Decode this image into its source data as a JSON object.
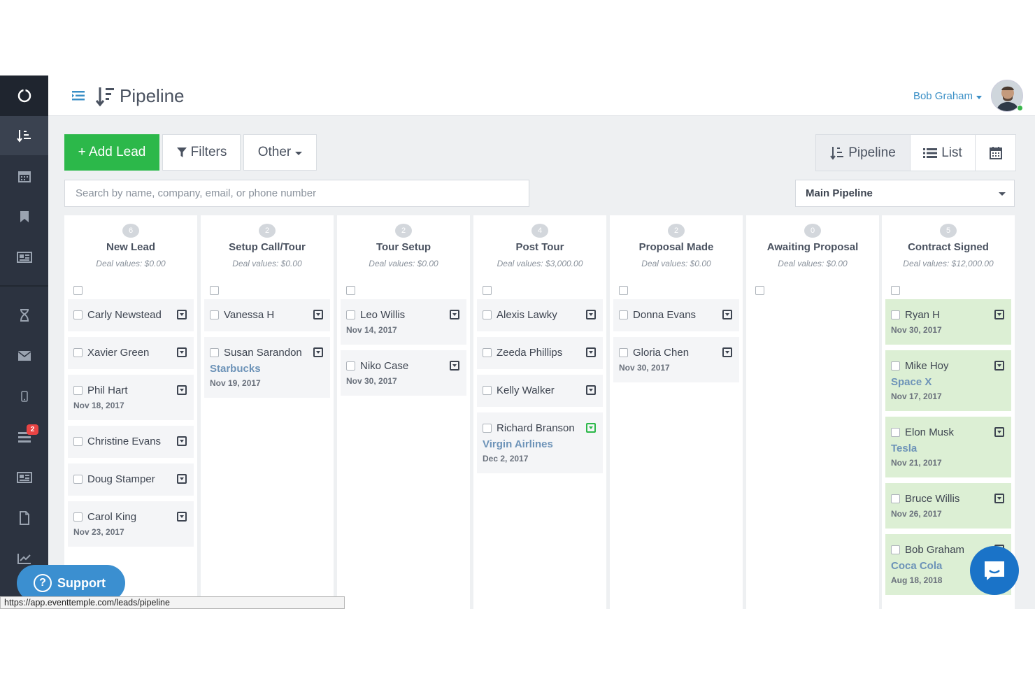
{
  "header": {
    "title": "Pipeline",
    "user_name": "Bob Graham"
  },
  "sidebar": {
    "items": [
      {
        "icon": "logo-ring-icon"
      },
      {
        "icon": "pipeline-icon",
        "active": true
      },
      {
        "icon": "calendar-icon"
      },
      {
        "icon": "bookmark-icon"
      },
      {
        "icon": "newspaper-icon"
      },
      {
        "icon": "hourglass-icon"
      },
      {
        "icon": "envelope-icon"
      },
      {
        "icon": "mobile-icon"
      },
      {
        "icon": "tasks-icon",
        "badge": "2"
      },
      {
        "icon": "newspaper-icon"
      },
      {
        "icon": "document-icon"
      },
      {
        "icon": "chart-icon"
      }
    ]
  },
  "toolbar": {
    "add_lead": "+ Add Lead",
    "filters": "Filters",
    "other": "Other",
    "view_pipeline": "Pipeline",
    "view_list": "List"
  },
  "search": {
    "placeholder": "Search by name, company, email, or phone number",
    "value": ""
  },
  "pipeline_select": {
    "value": "Main Pipeline"
  },
  "columns": [
    {
      "count": "6",
      "name": "New Lead",
      "deal_value": "Deal values: $0.00",
      "cards": [
        {
          "name": "Carly Newstead"
        },
        {
          "name": "Xavier Green"
        },
        {
          "name": "Phil Hart",
          "date": "Nov 18, 2017"
        },
        {
          "name": "Christine Evans"
        },
        {
          "name": "Doug Stamper"
        },
        {
          "name": "Carol King",
          "date": "Nov 23, 2017"
        }
      ]
    },
    {
      "count": "2",
      "name": "Setup Call/Tour",
      "deal_value": "Deal values: $0.00",
      "cards": [
        {
          "name": "Vanessa H"
        },
        {
          "name": "Susan Sarandon",
          "company": "Starbucks",
          "date": "Nov 19, 2017"
        }
      ]
    },
    {
      "count": "2",
      "name": "Tour Setup",
      "deal_value": "Deal values: $0.00",
      "cards": [
        {
          "name": "Leo Willis",
          "date": "Nov 14, 2017"
        },
        {
          "name": "Niko Case",
          "date": "Nov 30, 2017"
        }
      ]
    },
    {
      "count": "4",
      "name": "Post Tour",
      "deal_value": "Deal values: $3,000.00",
      "cards": [
        {
          "name": "Alexis Lawky"
        },
        {
          "name": "Zeeda Phillips"
        },
        {
          "name": "Kelly Walker"
        },
        {
          "name": "Richard Branson",
          "company": "Virgin Airlines",
          "date": "Dec 2, 2017",
          "menu_active": true
        }
      ]
    },
    {
      "count": "2",
      "name": "Proposal Made",
      "deal_value": "Deal values: $0.00",
      "cards": [
        {
          "name": "Donna Evans"
        },
        {
          "name": "Gloria Chen",
          "date": "Nov 30, 2017"
        }
      ]
    },
    {
      "count": "0",
      "name": "Awaiting Proposal",
      "deal_value": "Deal values: $0.00",
      "cards": []
    },
    {
      "count": "5",
      "name": "Contract Signed",
      "deal_value": "Deal values: $12,000.00",
      "green": true,
      "cards": [
        {
          "name": "Ryan H",
          "date": "Nov 30, 2017"
        },
        {
          "name": "Mike Hoy",
          "company": "Space X",
          "date": "Nov 17, 2017"
        },
        {
          "name": "Elon Musk",
          "company": "Tesla",
          "date": "Nov 21, 2017"
        },
        {
          "name": "Bruce Willis",
          "date": "Nov 26, 2017"
        },
        {
          "name": "Bob Graham",
          "company": "Coca Cola",
          "date": "Aug 18, 2018"
        }
      ]
    }
  ],
  "support": {
    "label": "Support"
  },
  "status_bar": {
    "url": "https://app.eventtemple.com/leads/pipeline"
  },
  "colors": {
    "accent_green": "#2cb84a",
    "link_blue": "#3a8fc6",
    "sidebar": "#2c3340"
  }
}
